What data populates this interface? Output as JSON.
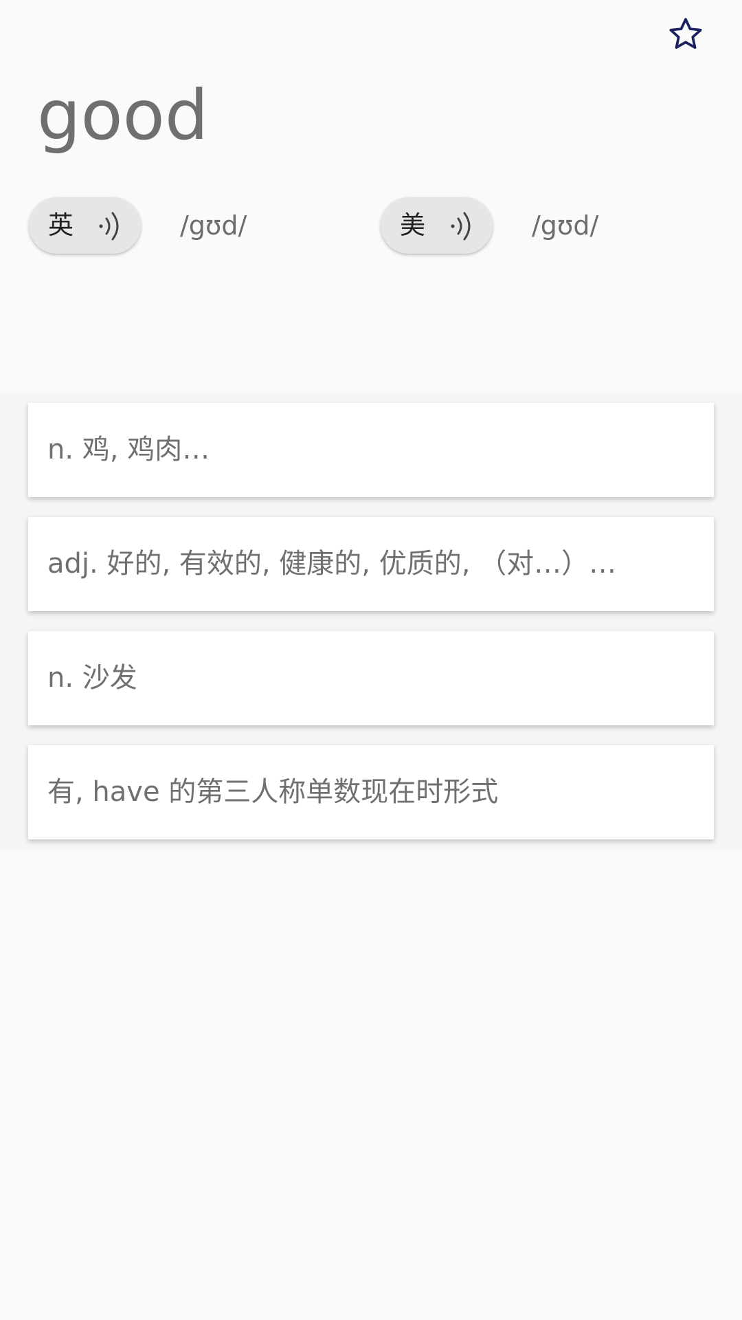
{
  "header": {
    "favorite_icon": "star-outline-icon",
    "favorite_color": "#1a2060"
  },
  "word": "good",
  "pronunciations": [
    {
      "region": "英",
      "phonetic": "/gʊd/",
      "icon": "speaker-icon"
    },
    {
      "region": "美",
      "phonetic": "/gʊd/",
      "icon": "speaker-icon"
    }
  ],
  "definitions": [
    {
      "text": "n. 鸡, 鸡肉…"
    },
    {
      "text": "adj. 好的, 有效的, 健康的, 优质的, （对…）…"
    },
    {
      "text": "n. 沙发"
    },
    {
      "text": " 有, have 的第三人称单数现在时形式"
    }
  ]
}
